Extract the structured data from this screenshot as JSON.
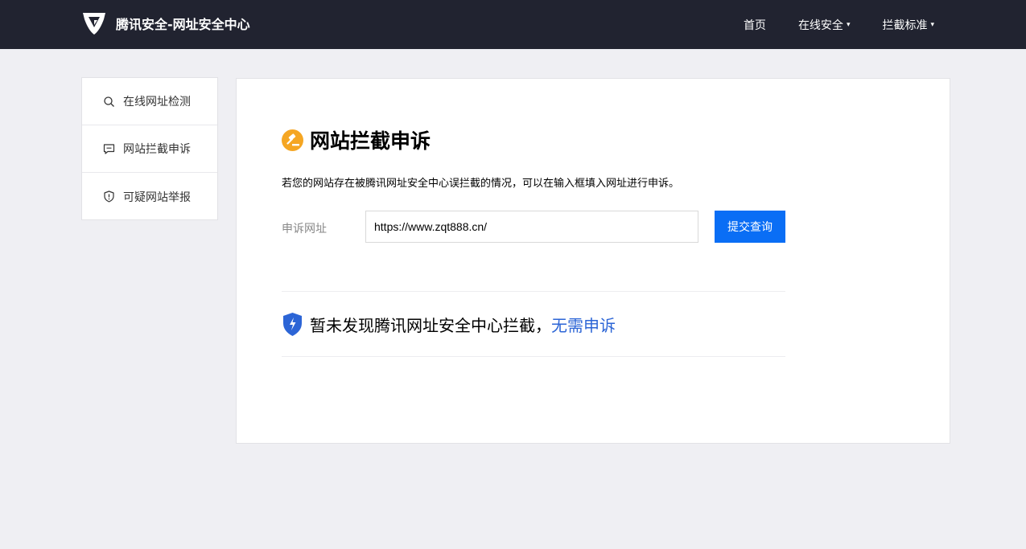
{
  "header": {
    "brand_title": "腾讯安全-网址安全中心",
    "logo_icon": "tencent-security-shield-logo",
    "nav": [
      {
        "label": "首页",
        "has_dropdown": false
      },
      {
        "label": "在线安全",
        "has_dropdown": true
      },
      {
        "label": "拦截标准",
        "has_dropdown": true
      }
    ],
    "caret": "▾"
  },
  "sidebar": {
    "items": [
      {
        "label": "在线网址检测",
        "icon": "search-icon"
      },
      {
        "label": "网站拦截申诉",
        "icon": "chat-bubble-icon"
      },
      {
        "label": "可疑网站举报",
        "icon": "shield-alert-icon"
      }
    ]
  },
  "main": {
    "title": "网站拦截申诉",
    "title_icon": "gavel-icon",
    "description": "若您的网站存在被腾讯网址安全中心误拦截的情况，可以在输入框填入网址进行申诉。",
    "form": {
      "label": "申诉网址",
      "url_value": "https://www.zqt888.cn/",
      "submit_label": "提交查询"
    },
    "result": {
      "icon": "shield-bolt-icon",
      "text": "暂未发现腾讯网址安全中心拦截，",
      "accent_text": "无需申诉"
    }
  },
  "colors": {
    "topbar_bg": "#212330",
    "page_bg": "#efeff3",
    "primary_button": "#0a6ef5",
    "accent_text": "#2c65d6",
    "title_icon": "#f5a623",
    "result_shield": "#2c65d6"
  }
}
